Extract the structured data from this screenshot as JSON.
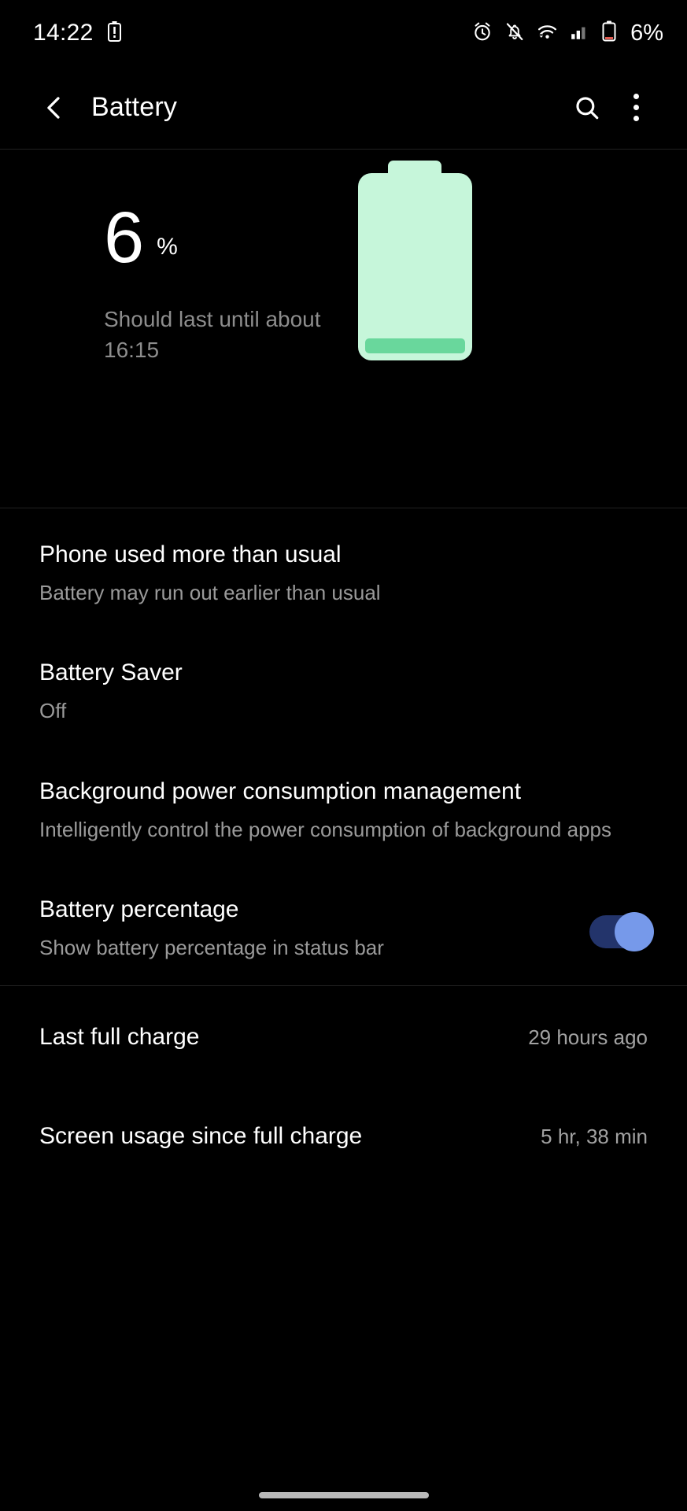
{
  "status_bar": {
    "clock": "14:22",
    "battery_percent_label": "6%",
    "icons": [
      "battery-alert-icon",
      "alarm-icon",
      "notifications-off-icon",
      "wifi-icon",
      "cellular-signal-icon",
      "battery-low-icon"
    ]
  },
  "toolbar": {
    "title": "Battery",
    "back_icon": "back-arrow-icon",
    "search_icon": "search-icon",
    "overflow_icon": "more-options-icon"
  },
  "hero": {
    "percent": "6",
    "percent_symbol": "%",
    "estimate": "Should last until about 16:15",
    "battery_fill_color": "#c6f6da",
    "battery_level_color": "#69d79c"
  },
  "settings": [
    {
      "title": "Phone used more than usual",
      "subtitle": "Battery may run out earlier than usual"
    },
    {
      "title": "Battery Saver",
      "subtitle": "Off"
    },
    {
      "title": "Background power consumption management",
      "subtitle": "Intelligently control the power consumption of background apps"
    },
    {
      "title": "Battery percentage",
      "subtitle": "Show battery percentage in status bar",
      "toggle_on": true
    }
  ],
  "stats": [
    {
      "label": "Last full charge",
      "value": "29 hours ago"
    },
    {
      "label": "Screen usage since full charge",
      "value": "5 hr, 38 min"
    }
  ],
  "accent": {
    "toggle_track": "#23346b",
    "toggle_thumb": "#7699ea"
  }
}
